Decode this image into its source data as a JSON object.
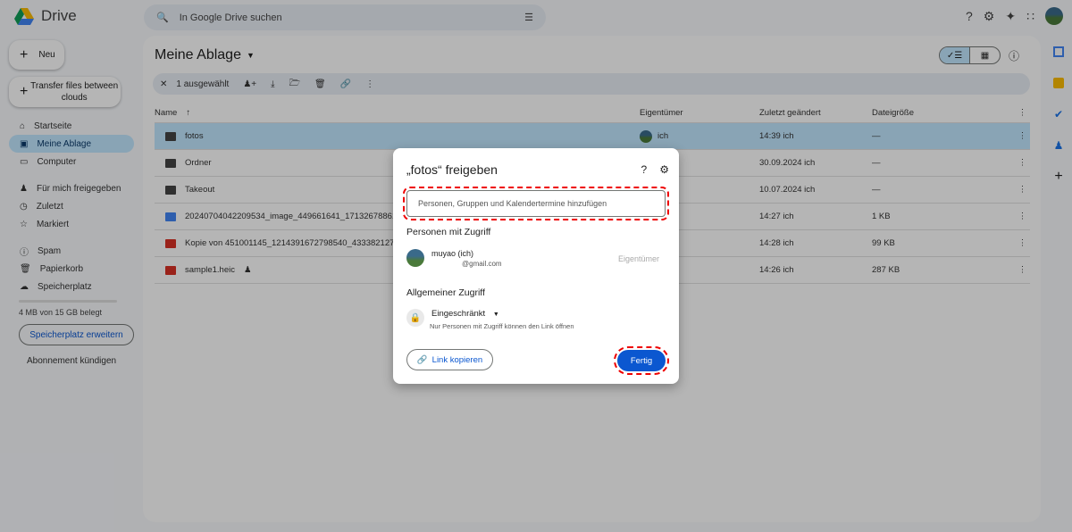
{
  "app": {
    "name": "Drive",
    "search_placeholder": "In Google Drive suchen"
  },
  "sidebar": {
    "new_label": "Neu",
    "transfer_label": "Transfer files between clouds",
    "items": [
      {
        "label": "Startseite",
        "icon": "home-icon"
      },
      {
        "label": "Meine Ablage",
        "icon": "drive-icon",
        "selected": true
      },
      {
        "label": "Computer",
        "icon": "computer-icon"
      },
      {
        "label": "Für mich freigegeben",
        "icon": "people-icon"
      },
      {
        "label": "Zuletzt",
        "icon": "clock-icon"
      },
      {
        "label": "Markiert",
        "icon": "star-icon"
      },
      {
        "label": "Spam",
        "icon": "spam-icon"
      },
      {
        "label": "Papierkorb",
        "icon": "trash-icon"
      },
      {
        "label": "Speicherplatz",
        "icon": "cloud-icon"
      }
    ],
    "storage_text": "4 MB von 15 GB belegt",
    "storage_button": "Speicherplatz erweitern",
    "cancel_subscription": "Abonnement kündigen"
  },
  "main": {
    "title": "Meine Ablage",
    "selection_count": "1 ausgewählt",
    "columns": {
      "name": "Name",
      "owner": "Eigentümer",
      "modified": "Zuletzt geändert",
      "size": "Dateigröße"
    },
    "files": [
      {
        "name": "fotos",
        "type": "folder",
        "owner": "ich",
        "modified": "14:39 ich",
        "size": "—",
        "selected": true
      },
      {
        "name": "Ordner",
        "type": "folder",
        "owner": "",
        "modified": "30.09.2024 ich",
        "size": "—"
      },
      {
        "name": "Takeout",
        "type": "folder",
        "owner": "",
        "modified": "10.07.2024 ich",
        "size": "—"
      },
      {
        "name": "20240704042209534_image_449661641_1713267886148",
        "type": "doc",
        "owner": "",
        "modified": "14:27 ich",
        "size": "1 KB"
      },
      {
        "name": "Kopie von 451001145_1214391672798540_4333821277379",
        "type": "image",
        "owner": "",
        "modified": "14:28 ich",
        "size": "99 KB"
      },
      {
        "name": "sample1.heic",
        "type": "image",
        "owner": "",
        "modified": "14:26 ich",
        "size": "287 KB",
        "shared": true
      }
    ]
  },
  "dialog": {
    "title": "„fotos“ freigeben",
    "input_placeholder": "Personen, Gruppen und Kalendertermine hinzufügen",
    "people_heading": "Personen mit Zugriff",
    "person_name": "muyao (ich)",
    "person_email": "@gmail.com",
    "person_role": "Eigentümer",
    "general_heading": "Allgemeiner Zugriff",
    "access_level": "Eingeschränkt",
    "access_desc": "Nur Personen mit Zugriff können den Link öffnen",
    "copy_link": "Link kopieren",
    "done": "Fertig"
  },
  "colors": {
    "accent": "#0b57d0",
    "selected": "#c2e7ff",
    "highlight": "#ee0000"
  }
}
